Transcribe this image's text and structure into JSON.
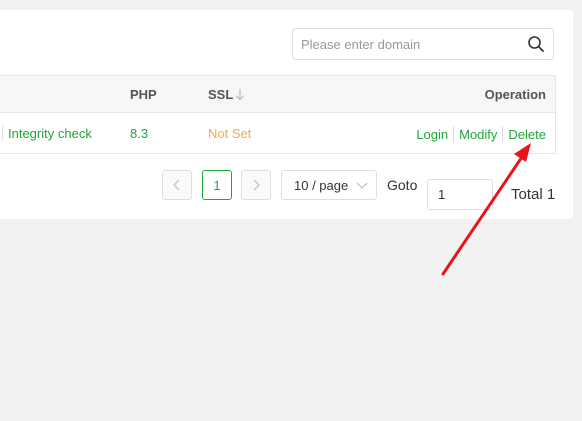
{
  "search": {
    "placeholder": "Please enter domain",
    "icon": "search-icon"
  },
  "table": {
    "headers": {
      "php": "PHP",
      "ssl": "SSL",
      "operation": "Operation"
    },
    "rows": [
      {
        "check": "Integrity check",
        "php": "8.3",
        "ssl": "Not Set",
        "ops": {
          "login": "Login",
          "modify": "Modify",
          "delete": "Delete"
        }
      }
    ]
  },
  "pagination": {
    "current_page": "1",
    "page_size": "10 / page",
    "goto_label": "Goto",
    "goto_value": "1",
    "total": "Total 1"
  },
  "colors": {
    "accent": "#20a53a",
    "warning": "#f0ad4e",
    "annotation": "#e8141b"
  }
}
